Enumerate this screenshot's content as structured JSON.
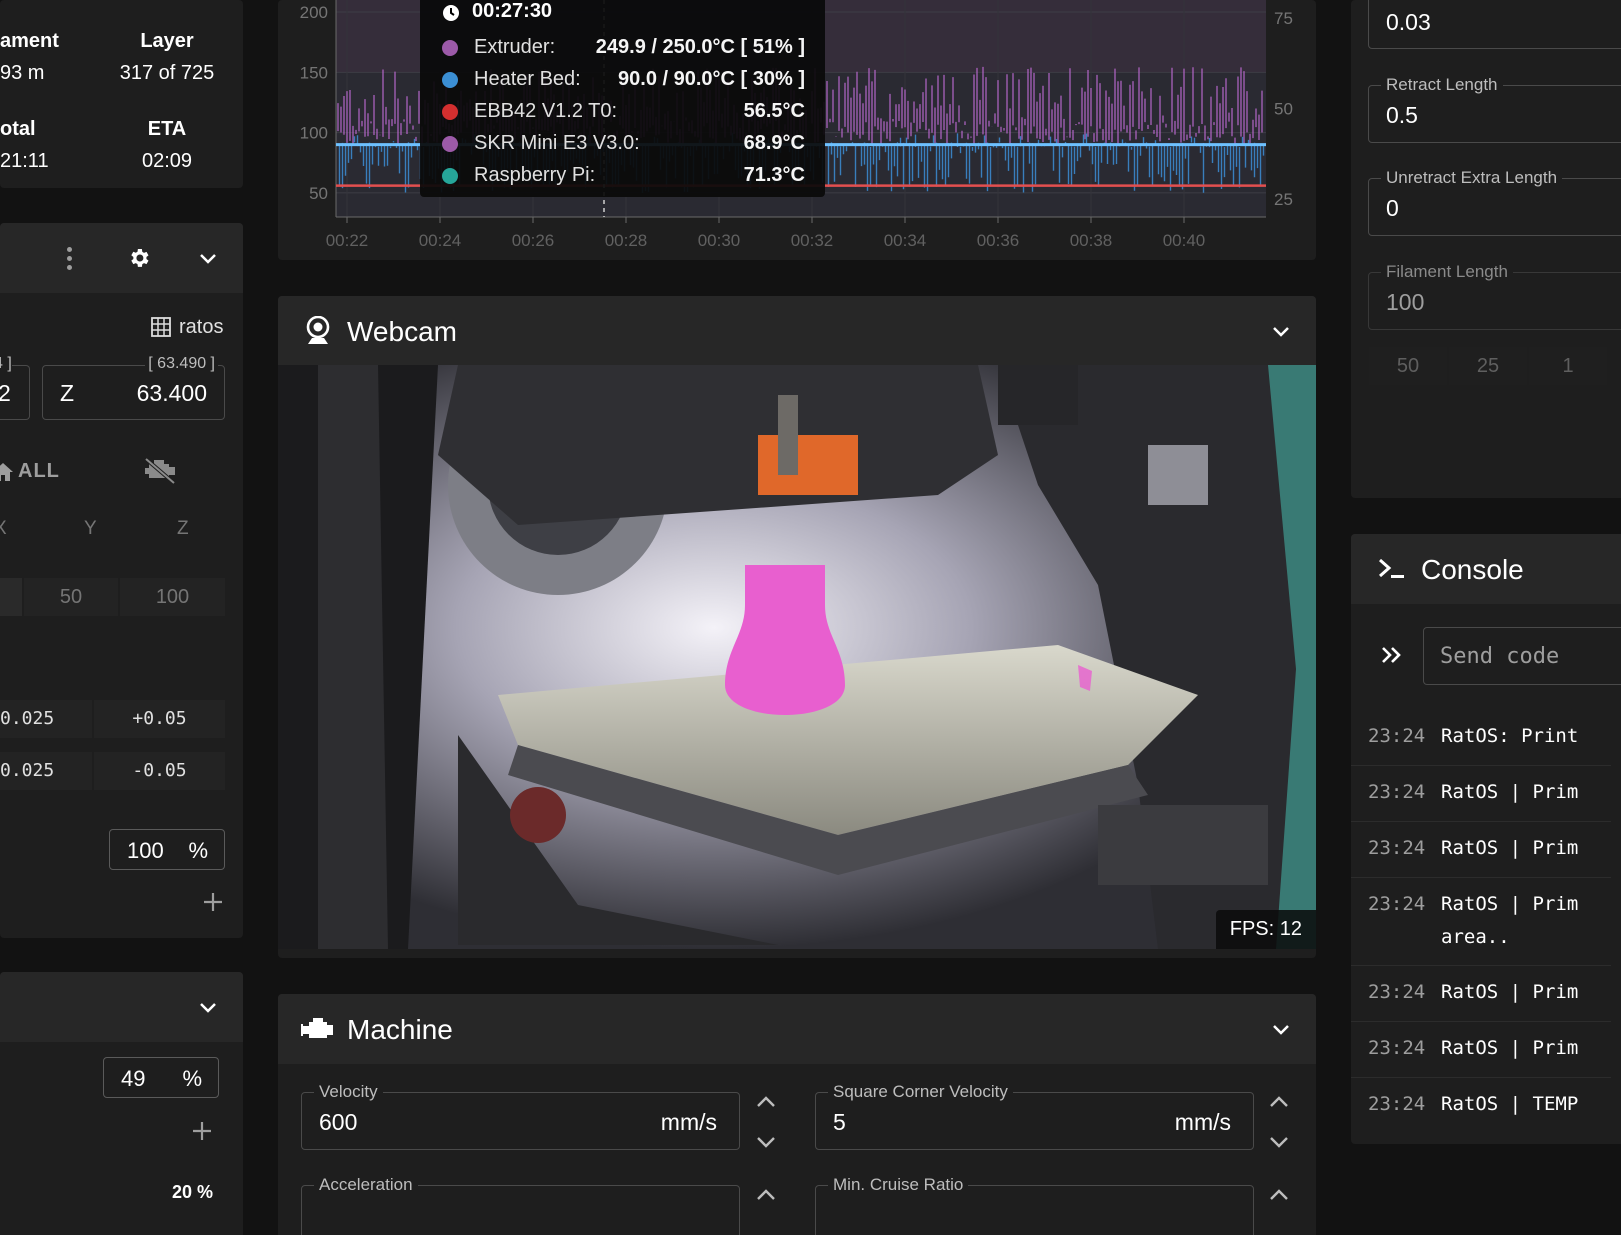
{
  "status_panel": {
    "filament_label": "ament",
    "filament_value": "93 m",
    "layer_label": "Layer",
    "layer_value": "317 of 725",
    "total_label": "otal",
    "total_value": "21:11",
    "eta_label": "ETA",
    "eta_value": "02:09"
  },
  "toolhead": {
    "macro_label": "ratos",
    "x_or_y_frag_top": "4 ]",
    "x_or_y_frag_val": "2",
    "z_label": "Z",
    "z_bracket": "[ 63.490 ]",
    "z_value": "63.400",
    "home_all": "ALL",
    "axis_x": "X",
    "axis_y": "Y",
    "axis_z": "Z",
    "steps": [
      "50",
      "100"
    ],
    "zoffset_rows": [
      {
        "minus": "0.025",
        "plus": "+0.05"
      },
      {
        "minus": "0.025",
        "plus": "-0.05"
      }
    ],
    "speed_factor": "100",
    "percent": "%"
  },
  "fans_panel": {
    "value": "49",
    "percent": "%",
    "bottom_value": "20 %"
  },
  "temp_chart": {
    "tooltip_time": "00:27:30",
    "sensors": [
      {
        "name": "Extruder:",
        "value": "249.9 / 250.0°C [ 51% ]",
        "color": "#9c5aa8"
      },
      {
        "name": "Heater Bed:",
        "value": "90.0 / 90.0°C [ 30% ]",
        "color": "#3b8fd4"
      },
      {
        "name": "EBB42 V1.2 T0:",
        "value": "56.5°C",
        "color": "#d32f2f"
      },
      {
        "name": "SKR Mini E3 V3.0:",
        "value": "68.9°C",
        "color": "#9c5aa8"
      },
      {
        "name": "Raspberry Pi:",
        "value": "71.3°C",
        "color": "#26a69a"
      }
    ],
    "y_left": [
      "200",
      "150",
      "100",
      "50"
    ],
    "y_right": [
      "75",
      "50",
      "25"
    ],
    "x_ticks": [
      "00:22",
      "00:24",
      "00:26",
      "00:28",
      "00:30",
      "00:32",
      "00:34",
      "00:36",
      "00:38",
      "00:40"
    ]
  },
  "chart_data": {
    "type": "line",
    "x_ticks": [
      "00:22",
      "00:24",
      "00:26",
      "00:28",
      "00:30",
      "00:32",
      "00:34",
      "00:36",
      "00:38",
      "00:40"
    ],
    "ylim_left": [
      30,
      210
    ],
    "ylim_right": [
      20,
      80
    ],
    "series": [
      {
        "name": "Extruder",
        "approx_values": [
          100,
          140,
          100,
          140,
          100,
          140,
          100,
          140,
          100,
          140
        ]
      },
      {
        "name": "Heater Bed",
        "approx_values": [
          90,
          90,
          90,
          90,
          90,
          90,
          90,
          90,
          90,
          90
        ]
      },
      {
        "name": "EBB42 V1.2 T0",
        "approx_values": [
          56,
          56,
          56,
          56,
          56,
          56,
          56,
          56,
          56,
          56
        ]
      }
    ]
  },
  "webcam": {
    "title": "Webcam",
    "fps": "FPS: 12"
  },
  "machine": {
    "title": "Machine",
    "velocity_label": "Velocity",
    "velocity_value": "600",
    "velocity_unit": "mm/s",
    "scv_label": "Square Corner Velocity",
    "scv_value": "5",
    "scv_unit": "mm/s",
    "accel_label": "Acceleration",
    "mcr_label": "Min. Cruise Ratio"
  },
  "retraction": {
    "pa_value": "0.03",
    "retract_label": "Retract Length",
    "retract_value": "0.5",
    "unretract_label": "Unretract Extra Length",
    "unretract_value": "0",
    "filament_label": "Filament Length",
    "filament_value": "100",
    "steps": [
      "50",
      "25",
      "1"
    ]
  },
  "console": {
    "title": "Console",
    "placeholder": "Send code",
    "rows": [
      {
        "time": "23:24",
        "msg": "RatOS: Print"
      },
      {
        "time": "23:24",
        "msg": "RatOS | Prim"
      },
      {
        "time": "23:24",
        "msg": "RatOS | Prim"
      },
      {
        "time": "23:24",
        "msg": "RatOS | Prim",
        "msg2": "area.."
      },
      {
        "time": "23:24",
        "msg": "RatOS | Prim"
      },
      {
        "time": "23:24",
        "msg": "RatOS | Prim"
      },
      {
        "time": "23:24",
        "msg": "RatOS | TEMP"
      }
    ]
  }
}
